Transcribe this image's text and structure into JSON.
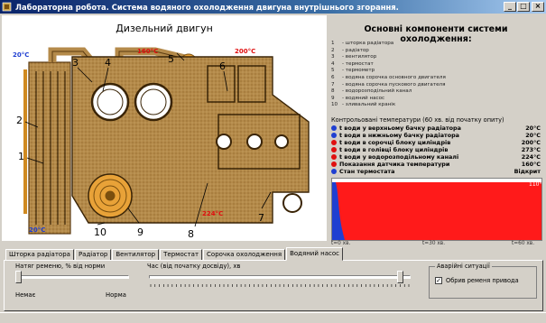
{
  "window": {
    "title": "Лабораторна робота. Система водяного охолодження двигуна внутрішнього згорання.",
    "buttons": {
      "minimize": "_",
      "maximize": "□",
      "close": "×"
    }
  },
  "diagram": {
    "title": "Дизельний двигун",
    "callouts": [
      "1",
      "2",
      "3",
      "4",
      "5",
      "6",
      "7",
      "8",
      "9",
      "10"
    ],
    "temps": {
      "top_left": "20°C",
      "thermostat": "160°C",
      "block_top": "200°C",
      "head": "224°C",
      "bottom_left": "20°C"
    }
  },
  "components": {
    "title": "Основні компоненти системи охолодження:",
    "items": [
      {
        "n": "1",
        "label": "- шторка радіатора"
      },
      {
        "n": "2",
        "label": "- радіатор"
      },
      {
        "n": "3",
        "label": "- вентилятор"
      },
      {
        "n": "4",
        "label": "- термостат"
      },
      {
        "n": "5",
        "label": "- термометр"
      },
      {
        "n": "6",
        "label": "- водяна сорочка основного двигателя"
      },
      {
        "n": "7",
        "label": "- водяна сорочка пускового двигателя"
      },
      {
        "n": "8",
        "label": "- водорозподільний канал"
      },
      {
        "n": "9",
        "label": "- водяний насос"
      },
      {
        "n": "10",
        "label": "- зливальний кранік"
      }
    ]
  },
  "control_temps": {
    "title": "Контрольовані температури (60 хв. від початку опиту)",
    "rows": [
      {
        "label": "t води у верхньому бачку радіатора",
        "value": "20°C",
        "color": "#1f3fd1"
      },
      {
        "label": "t води в нижньому бачку радіатора",
        "value": "20°C",
        "color": "#1f3fd1"
      },
      {
        "label": "t води в сорочці блоку циліндрів",
        "value": "200°C",
        "color": "#e01010"
      },
      {
        "label": "t води в голівці блоку циліндрів",
        "value": "273°C",
        "color": "#e01010"
      },
      {
        "label": "t води у водорозподільному каналі",
        "value": "224°C",
        "color": "#e01010"
      },
      {
        "label": "Показання датчика температури",
        "value": "160°C",
        "color": "#e01010"
      },
      {
        "label": "Стан термостата",
        "value": "Відкрит",
        "color": "#1f3fd1"
      }
    ]
  },
  "chart_data": {
    "type": "area",
    "x_labels": [
      "t=0 хв.",
      "t=30 хв.",
      "t=60 хв."
    ],
    "max_label": "110°",
    "colors": {
      "hot": "#ff1a1a",
      "cold": "#1f3fd1"
    }
  },
  "tabs": {
    "items": [
      {
        "label": "Шторка радіатора",
        "active": false
      },
      {
        "label": "Радіатор",
        "active": false
      },
      {
        "label": "Вентилятор",
        "active": false
      },
      {
        "label": "Термостат",
        "active": false
      },
      {
        "label": "Сорочка охолодження",
        "active": false
      },
      {
        "label": "Водяний насос",
        "active": true
      }
    ]
  },
  "controls": {
    "belt_label": "Натяг ременю, % від норми",
    "belt_min": "Немає",
    "belt_max": "Норма",
    "belt_level_percent": 0,
    "time_label": "Час (від початку досвіду), хв",
    "time_level_fraction": 0.97,
    "alarm_legend": "Аварійні ситуації",
    "alarm_checkbox_label": "Обрив ременя привода",
    "alarm_checkbox_checked": true,
    "alarm_checkbox_mark": "✓"
  }
}
